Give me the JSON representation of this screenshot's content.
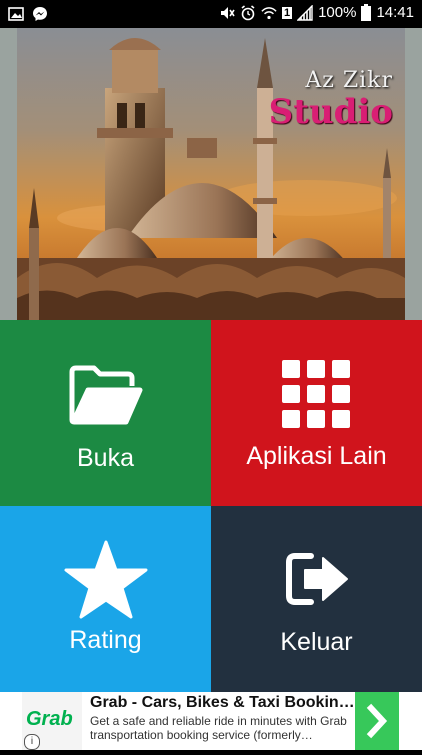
{
  "status_bar": {
    "battery_percent": "100%",
    "time": "14:41",
    "sim_indicator": "1",
    "icons": [
      "image-icon",
      "messenger-icon",
      "mute-icon",
      "alarm-icon",
      "wifi-icon",
      "signal-icon",
      "battery-icon"
    ]
  },
  "banner": {
    "brand_line1": "Az Zikr",
    "brand_line2": "Studio"
  },
  "menu": {
    "open_label": "Buka",
    "other_apps_label": "Aplikasi Lain",
    "rating_label": "Rating",
    "exit_label": "Keluar"
  },
  "colors": {
    "open": "#1c8a43",
    "other_apps": "#d0141c",
    "rating": "#1aa5e8",
    "exit": "#22303f",
    "brand_pink": "#d91e74"
  },
  "ad": {
    "logo_text": "Grab",
    "title": "Grab - Cars, Bikes & Taxi Bookin…",
    "description": "Get a safe and reliable ride in minutes with Grab transportation booking service (formerly…",
    "info": "i"
  }
}
